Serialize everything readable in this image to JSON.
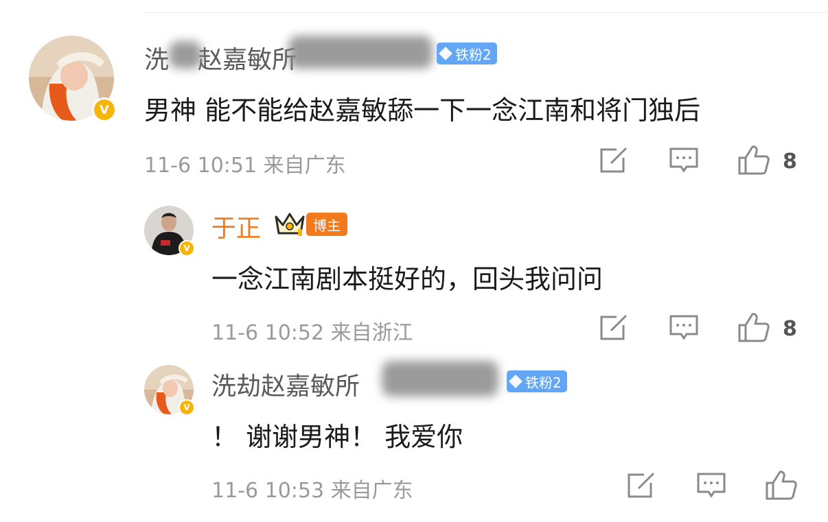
{
  "comments": [
    {
      "name_prefix": "洗",
      "name_middle": "赵嘉敏",
      "name_suffix": "所",
      "badge": "铁粉2",
      "content": "男神 能不能给赵嘉敏舔一下一念江南和将门独后",
      "date": "11-6 10:51",
      "location": "来自广东",
      "likes": "8"
    },
    {
      "name": "于正",
      "badge": "博主",
      "content": "一念江南剧本挺好的，回头我问问",
      "date": "11-6 10:52",
      "location": "来自浙江",
      "likes": "8"
    },
    {
      "name": "洗劫赵嘉敏所",
      "badge": "铁粉2",
      "content": "！ 谢谢男神！ 我爱你",
      "date": "11-6 10:53",
      "location": "来自广东",
      "likes": ""
    }
  ],
  "colors": {
    "blogger_name": "#f07b1c",
    "fan_badge": "#63a6f5",
    "blogger_badge": "#f17a1e",
    "verified_badge": "#f5b50a"
  },
  "icons": [
    "share-icon",
    "comment-icon",
    "like-icon",
    "verified-icon",
    "crown-icon",
    "diamond-icon"
  ]
}
